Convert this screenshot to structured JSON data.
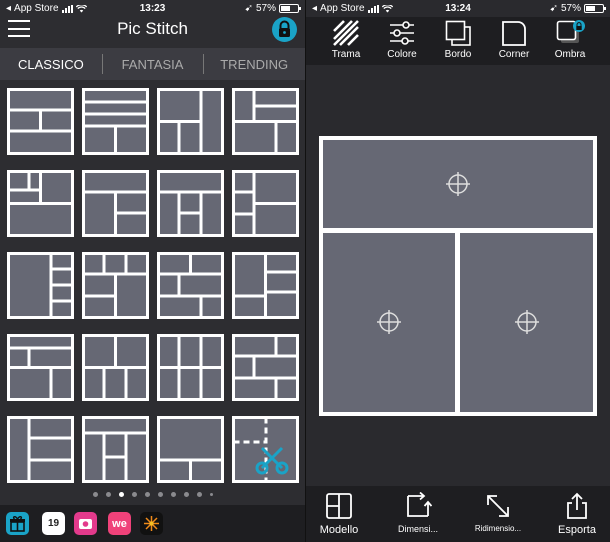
{
  "left": {
    "status": {
      "carrier": "App Store",
      "time": "13:23",
      "battery": "57%"
    },
    "title": "Pic Stitch",
    "tabs": [
      {
        "label": "CLASSICO",
        "active": true
      },
      {
        "label": "FANTASIA",
        "active": false
      },
      {
        "label": "TRENDING",
        "active": false
      }
    ],
    "templates_visible": 20,
    "page_count": 10,
    "page_current": 3,
    "dock_icons": [
      "gift-icon",
      "calendar-app-icon",
      "camera-app-icon",
      "weheart-app-icon",
      "sparkle-app-icon"
    ],
    "dock_calendar_text": "19",
    "dock_weheart_text": "we"
  },
  "right": {
    "status": {
      "carrier": "App Store",
      "time": "13:24",
      "battery": "57%"
    },
    "toolbar": [
      {
        "label": "Trama",
        "icon": "hatch-icon"
      },
      {
        "label": "Colore",
        "icon": "sliders-icon"
      },
      {
        "label": "Bordo",
        "icon": "border-icon"
      },
      {
        "label": "Corner",
        "icon": "corner-icon"
      },
      {
        "label": "Ombra",
        "icon": "shadow-icon"
      }
    ],
    "bottom": [
      {
        "label": "Modello",
        "icon": "layout-icon"
      },
      {
        "label": "Dimensi...",
        "icon": "resize-corner-icon"
      },
      {
        "label": "Ridimensio...",
        "icon": "diagonal-resize-icon"
      },
      {
        "label": "Esporta",
        "icon": "share-icon"
      }
    ]
  },
  "colors": {
    "accent": "#1aa3c7",
    "cell": "#666874",
    "panel": "#2d2d31",
    "bar": "#1e1e21"
  }
}
